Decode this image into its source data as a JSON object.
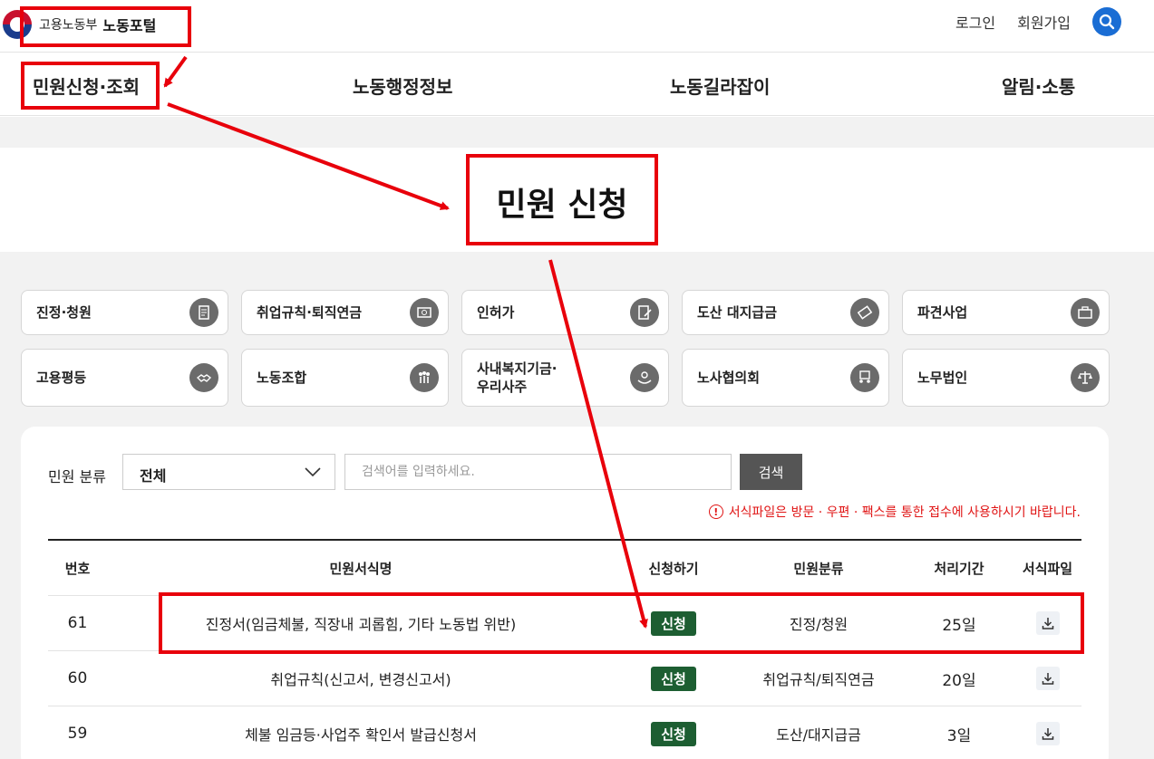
{
  "header": {
    "logo_ministry": "고용노동부",
    "logo_portal": "노동포털",
    "login": "로그인",
    "signup": "회원가입",
    "search_icon": "search-icon",
    "accent_color": "#1a6dd4"
  },
  "gnb": {
    "items": [
      {
        "label": "민원신청·조회"
      },
      {
        "label": "노동행정정보"
      },
      {
        "label": "노동길라잡이"
      },
      {
        "label": "알림·소통"
      }
    ]
  },
  "page_title": "민원 신청",
  "categories": [
    {
      "label": "진정·청원",
      "icon": "petition-icon"
    },
    {
      "label": "취업규칙·퇴직연금",
      "icon": "pension-icon"
    },
    {
      "label": "인허가",
      "icon": "permit-icon"
    },
    {
      "label": "도산 대지급금",
      "icon": "money-icon"
    },
    {
      "label": "파견사업",
      "icon": "briefcase-icon"
    },
    {
      "label": "고용평등",
      "icon": "handshake-icon"
    },
    {
      "label": "노동조합",
      "icon": "union-icon"
    },
    {
      "label": "사내복지기금·\n우리사주",
      "icon": "welfare-icon"
    },
    {
      "label": "노사협의회",
      "icon": "council-icon"
    },
    {
      "label": "노무법인",
      "icon": "scale-icon"
    }
  ],
  "filter": {
    "label": "민원 분류",
    "selected": "전체",
    "placeholder": "검색어를 입력하세요.",
    "search_button": "검색"
  },
  "notice": "서식파일은 방문 · 우편 · 팩스를 통한 접수에 사용하시기 바랍니다.",
  "table": {
    "headers": [
      "번호",
      "민원서식명",
      "신청하기",
      "민원분류",
      "처리기간",
      "서식파일"
    ],
    "rows": [
      {
        "no": "61",
        "name": "진정서(임금체불, 직장내 괴롭힘, 기타 노동법 위반)",
        "apply": "신청",
        "category": "진정/청원",
        "period": "25일"
      },
      {
        "no": "60",
        "name": "취업규칙(신고서, 변경신고서)",
        "apply": "신청",
        "category": "취업규칙/퇴직연금",
        "period": "20일"
      },
      {
        "no": "59",
        "name": "체불 임금등·사업주 확인서 발급신청서",
        "apply": "신청",
        "category": "도산/대지급금",
        "period": "3일"
      }
    ]
  },
  "colors": {
    "apply_button": "#1d5e32",
    "notice": "#e01414",
    "annotation": "#e8000b"
  }
}
